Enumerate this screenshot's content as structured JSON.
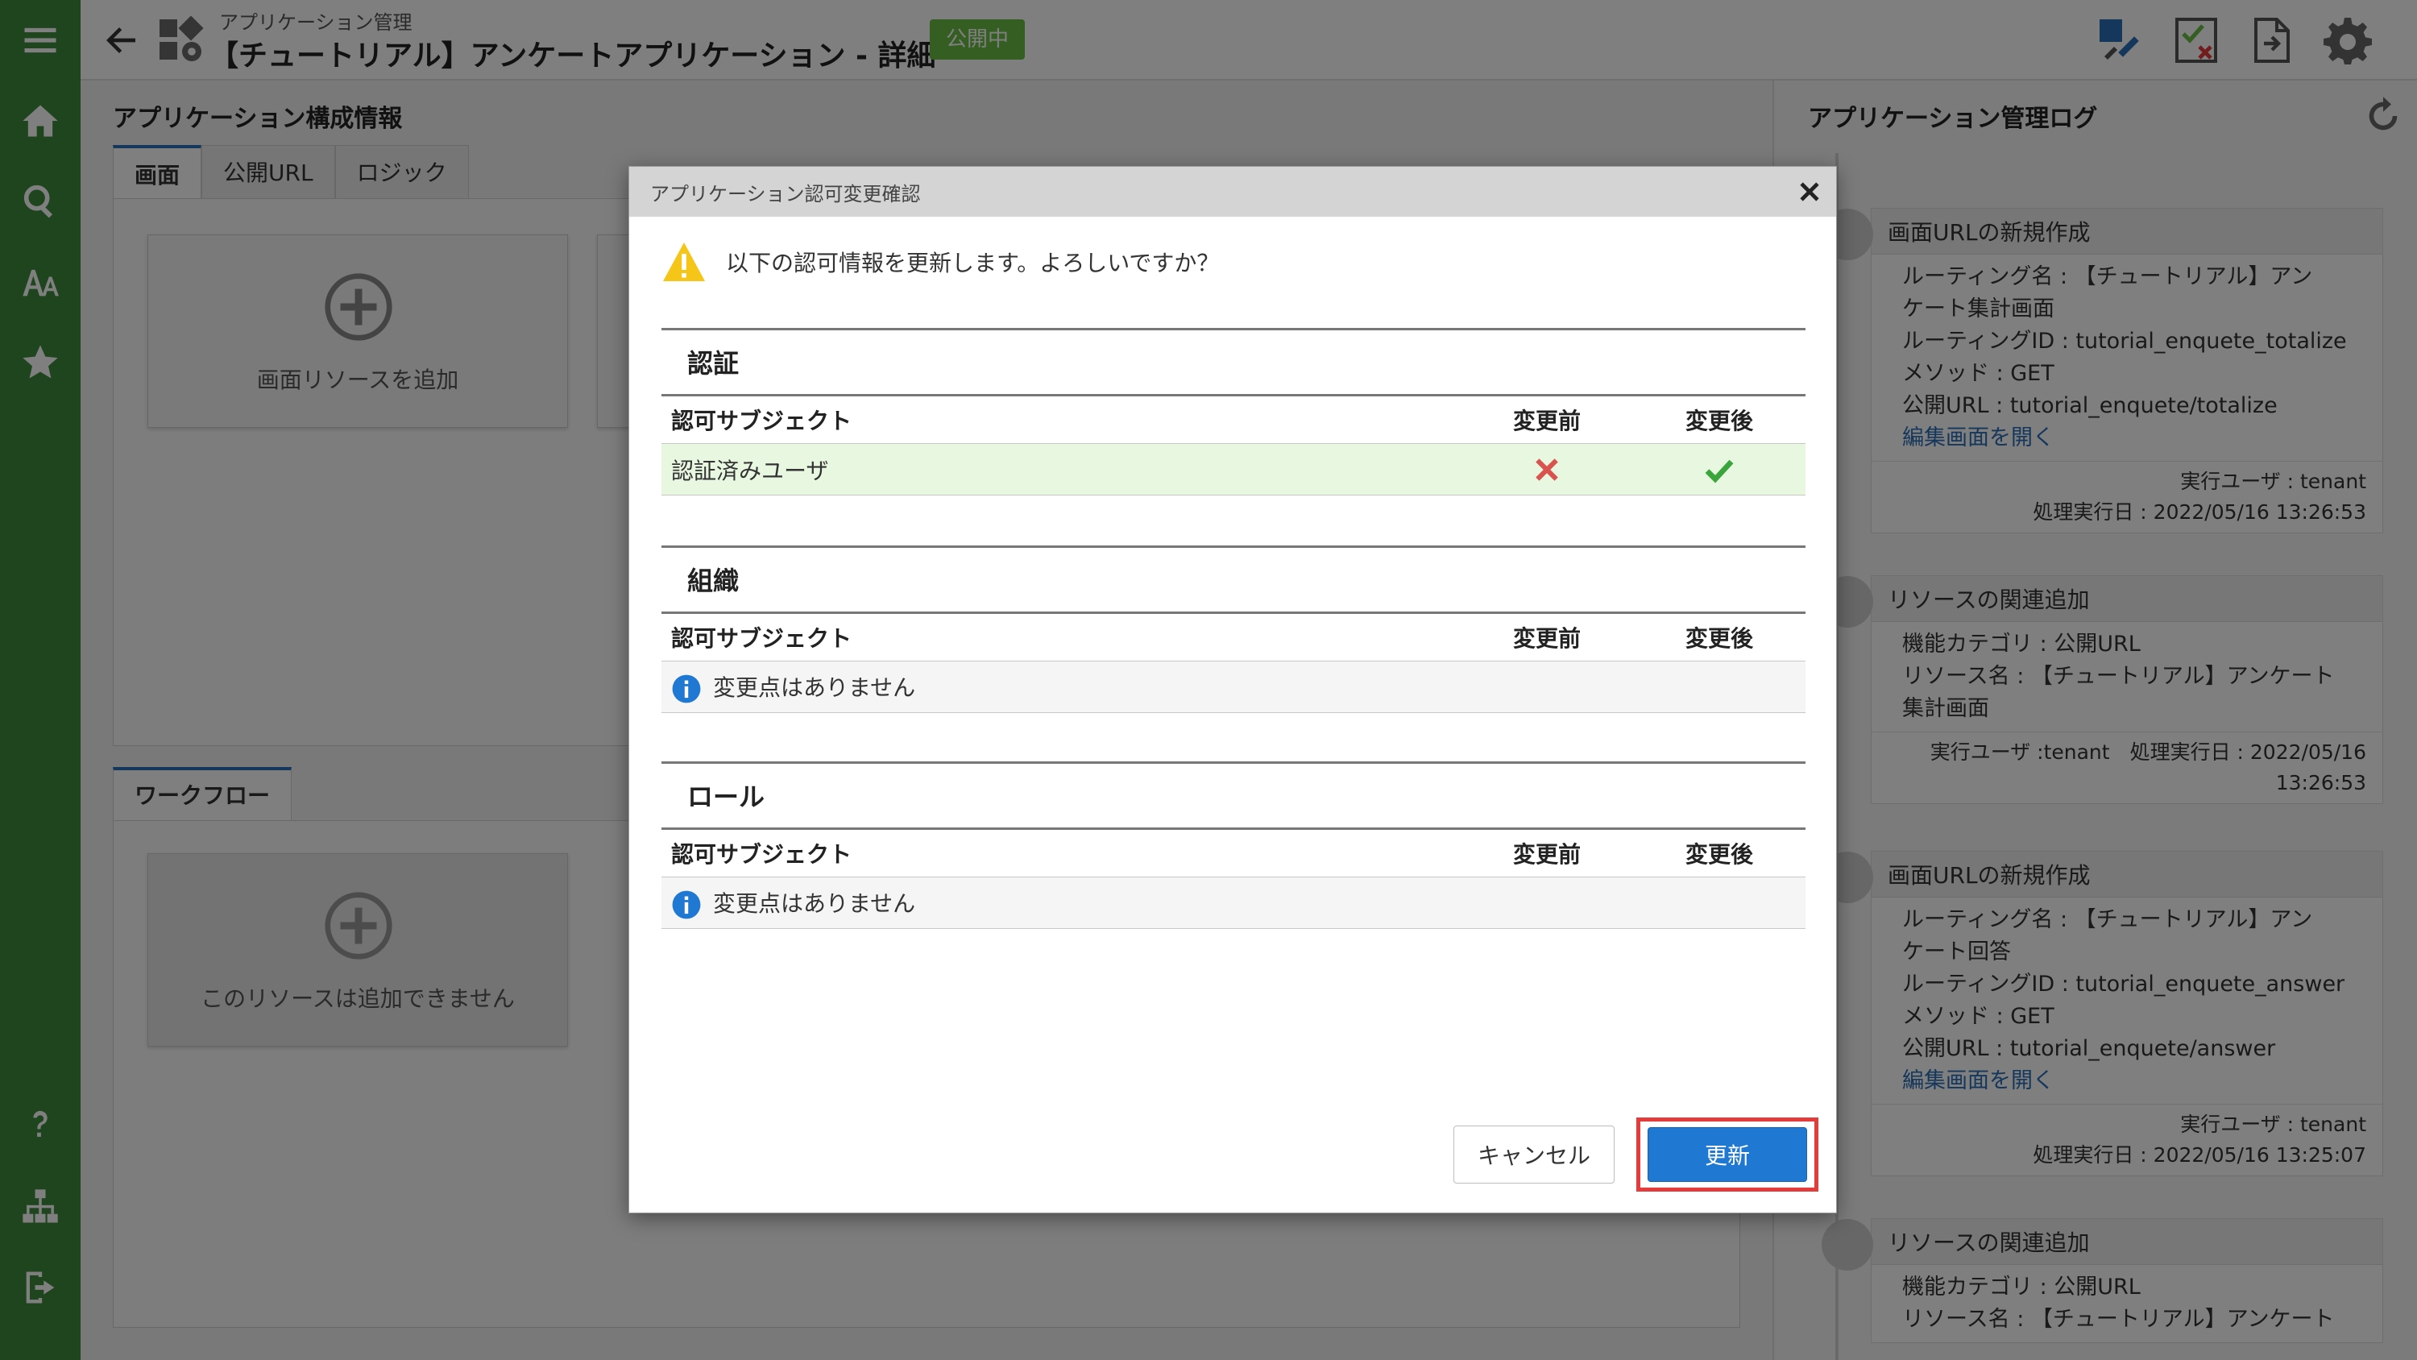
{
  "colors": {
    "sidebar": "#3d8a3d",
    "badge": "#6bbf45",
    "primary_button": "#1f78d1",
    "highlight": "#e53b3b",
    "changed_row": "#e8f7e0"
  },
  "sidebar": {
    "icons": [
      "menu-icon",
      "home-icon",
      "search-icon",
      "font-icon",
      "star-icon",
      "help-icon",
      "sitemap-icon",
      "logout-icon"
    ]
  },
  "header": {
    "breadcrumb": "アプリケーション管理",
    "title": "【チュートリアル】アンケートアプリケーション - 詳細",
    "status_badge": "公開中",
    "tools": [
      "edit-tool-icon",
      "checklist-icon",
      "export-icon",
      "gear-icon"
    ]
  },
  "main": {
    "section_title": "アプリケーション構成情報",
    "tabs": [
      {
        "label": "画面"
      },
      {
        "label": "公開URL"
      },
      {
        "label": "ロジック"
      }
    ],
    "add_screen_label": "画面リソースを追加",
    "workflow_tab": "ワークフロー",
    "workflow_add_label": "このリソースは追加できません"
  },
  "log": {
    "title": "アプリケーション管理ログ",
    "entries": [
      {
        "head": "画面URLの新規作成",
        "lines": [
          "ルーティング名 : 【チュートリアル】アン",
          "ケート集計画面",
          "ルーティングID : tutorial_enquete_totalize",
          "メソッド : GET",
          "公開URL : tutorial_enquete/totalize"
        ],
        "link": "編集画面を開く",
        "foot1": "実行ユーザ : tenant",
        "foot2": "処理実行日 : 2022/05/16 13:26:53"
      },
      {
        "head": "リソースの関連追加",
        "lines": [
          "機能カテゴリ : 公開URL",
          "リソース名 : 【チュートリアル】アンケート",
          "集計画面"
        ],
        "foot1": "実行ユーザ :tenant　処理実行日 : 2022/05/16",
        "foot2": "13:26:53"
      },
      {
        "head": "画面URLの新規作成",
        "lines": [
          "ルーティング名 : 【チュートリアル】アン",
          "ケート回答",
          "ルーティングID : tutorial_enquete_answer",
          "メソッド : GET",
          "公開URL : tutorial_enquete/answer"
        ],
        "link": "編集画面を開く",
        "foot1": "実行ユーザ : tenant",
        "foot2": "処理実行日 : 2022/05/16 13:25:07"
      },
      {
        "head": "リソースの関連追加",
        "lines": [
          "機能カテゴリ : 公開URL",
          "リソース名 : 【チュートリアル】アンケート"
        ]
      }
    ]
  },
  "dialog": {
    "title": "アプリケーション認可変更確認",
    "message": "以下の認可情報を更新します。よろしいですか？",
    "sections": [
      {
        "title": "認証",
        "col_subject": "認可サブジェクト",
        "col_before": "変更前",
        "col_after": "変更後",
        "row_label": "認証済みユーザ",
        "before": "denied",
        "after": "allowed"
      },
      {
        "title": "組織",
        "col_subject": "認可サブジェクト",
        "col_before": "変更前",
        "col_after": "変更後",
        "no_change": "変更点はありません"
      },
      {
        "title": "ロール",
        "col_subject": "認可サブジェクト",
        "col_before": "変更前",
        "col_after": "変更後",
        "no_change": "変更点はありません"
      }
    ],
    "cancel_label": "キャンセル",
    "update_label": "更新"
  }
}
